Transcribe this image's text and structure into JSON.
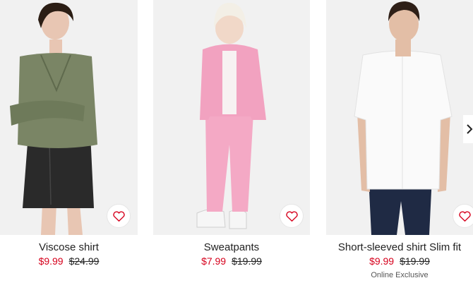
{
  "products": [
    {
      "name": "Viscose shirt",
      "sale_price": "$9.99",
      "original_price": "$24.99",
      "badge": ""
    },
    {
      "name": "Sweatpants",
      "sale_price": "$7.99",
      "original_price": "$19.99",
      "badge": ""
    },
    {
      "name": "Short-sleeved shirt Slim fit",
      "sale_price": "$9.99",
      "original_price": "$19.99",
      "badge": "Online Exclusive"
    }
  ],
  "icons": {
    "favorite": "heart-icon",
    "next": "chevron-right-icon"
  },
  "colors": {
    "sale_price": "#d6001c",
    "heart": "#d6001c",
    "text": "#222222",
    "image_bg": "#f1f1f1"
  }
}
